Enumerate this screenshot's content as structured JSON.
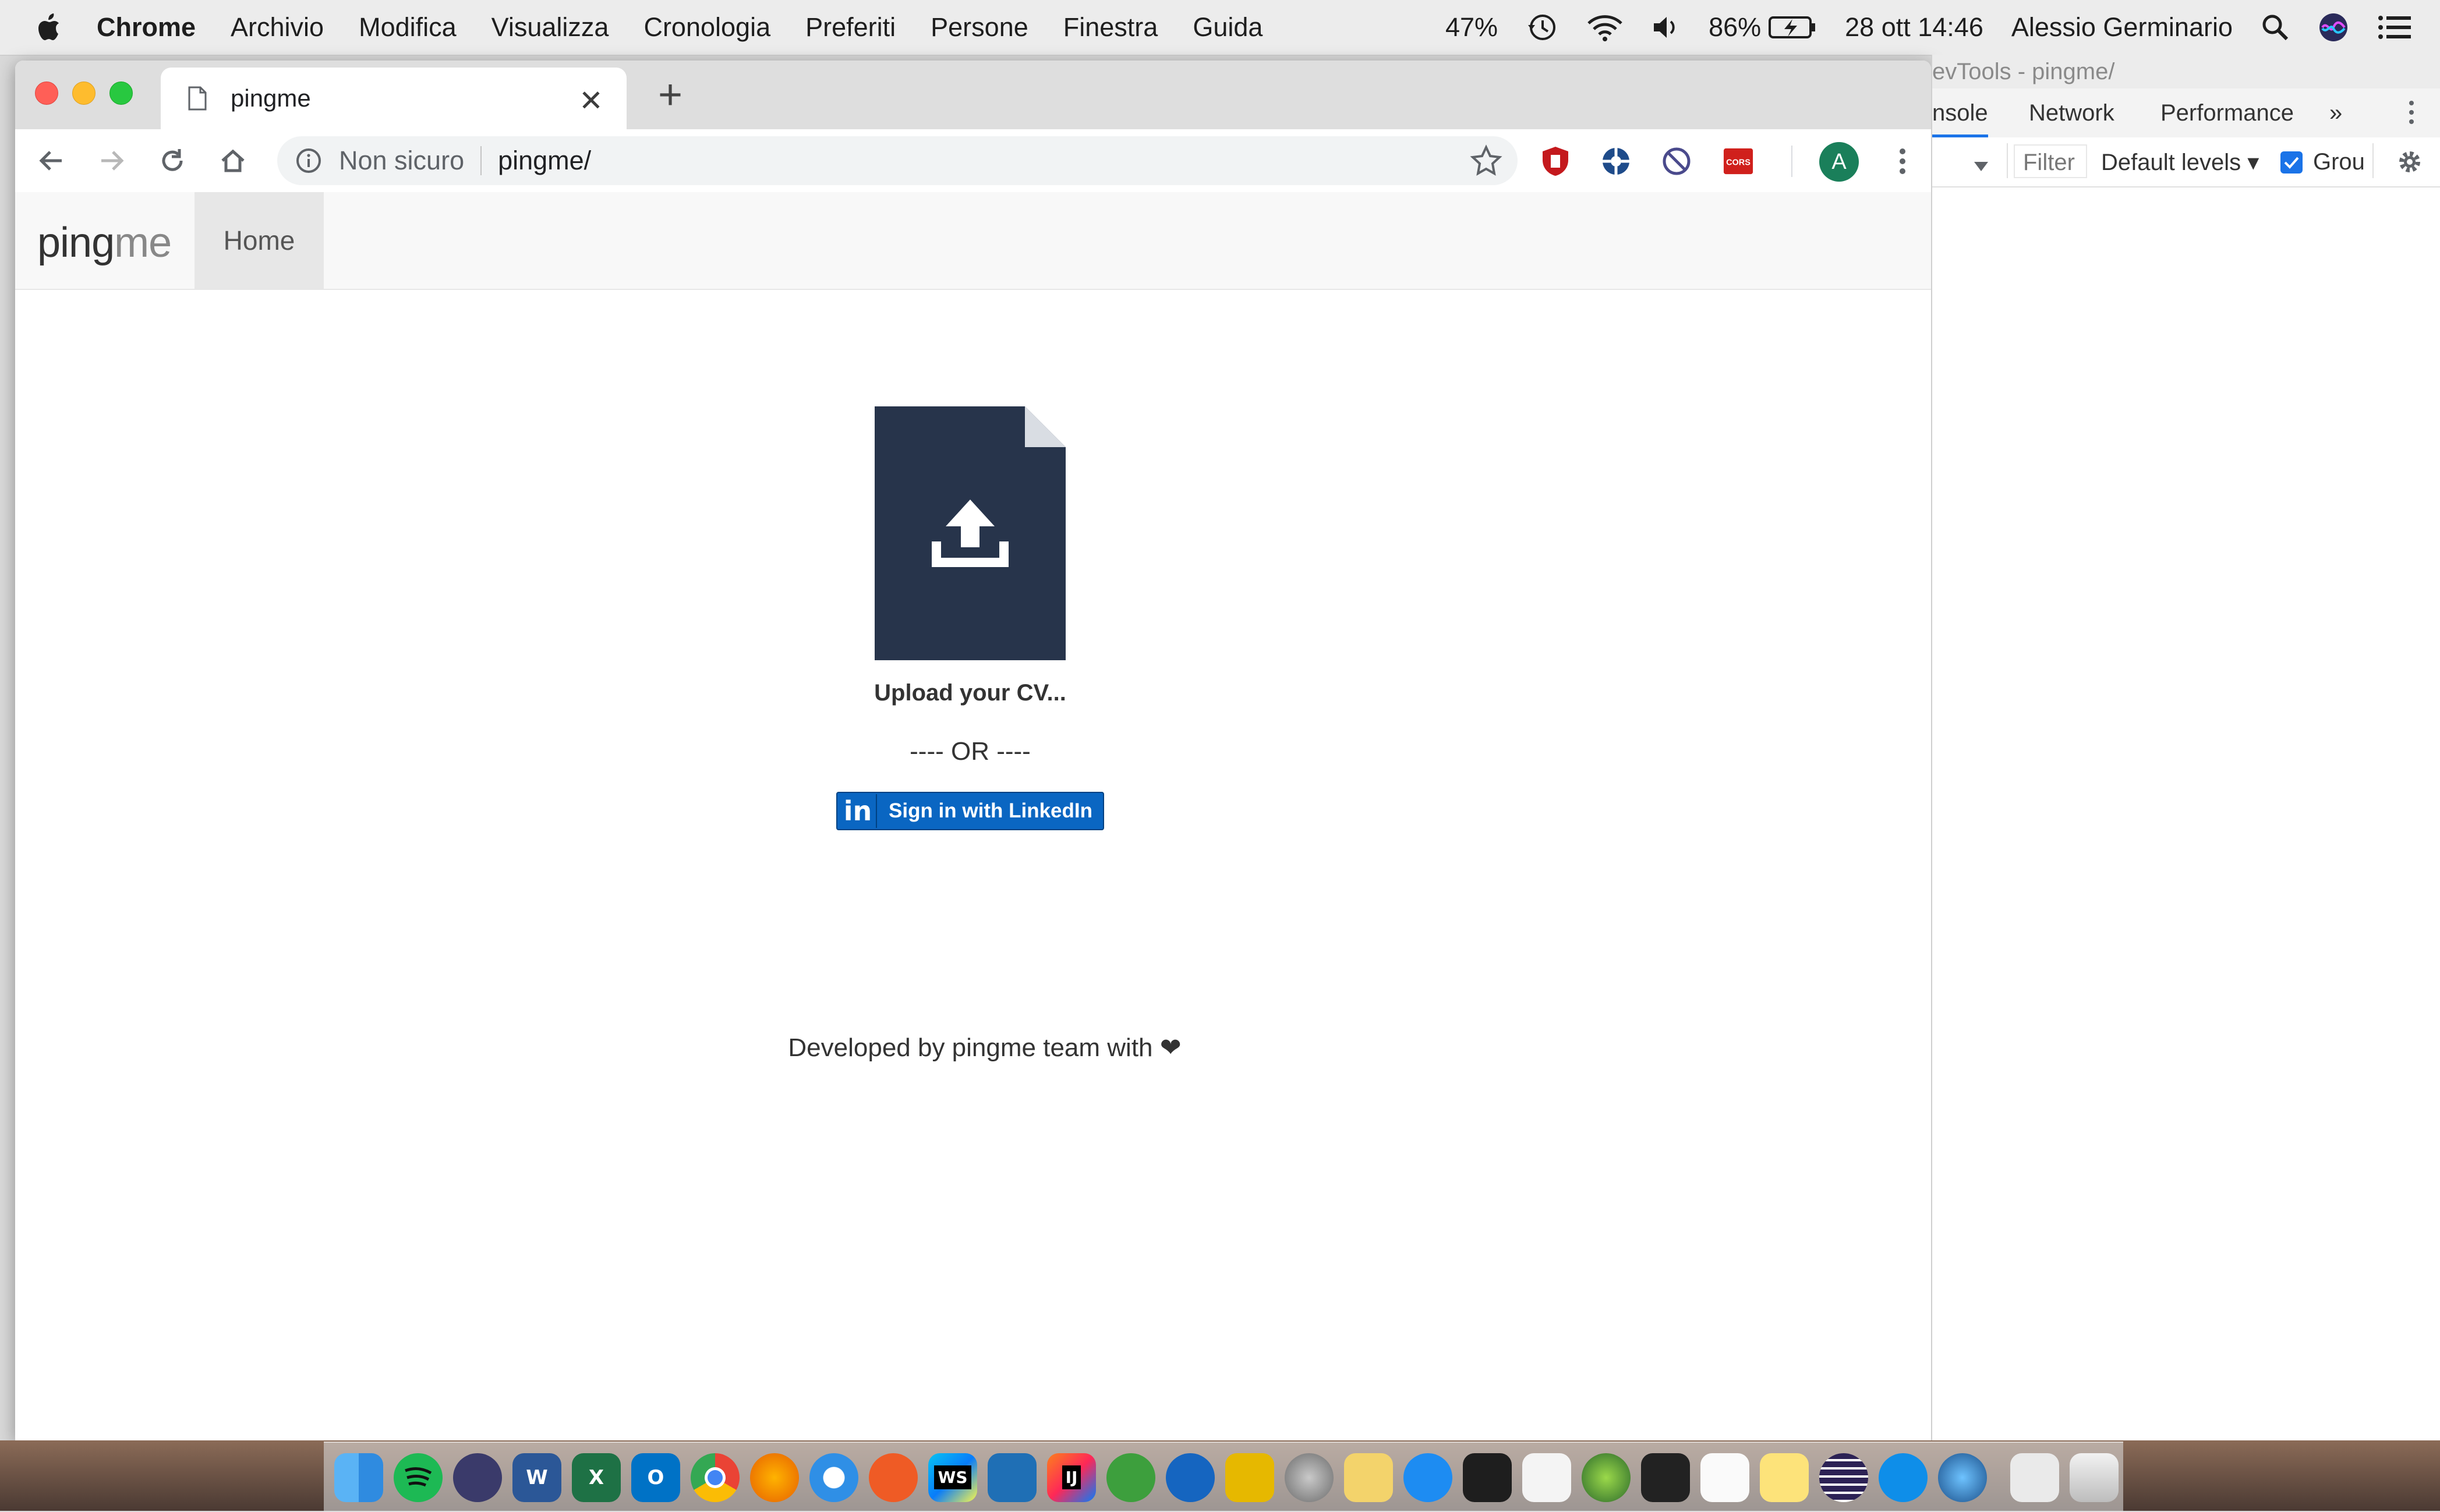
{
  "menubar": {
    "app_name": "Chrome",
    "menus": [
      "Archivio",
      "Modifica",
      "Visualizza",
      "Cronologia",
      "Preferiti",
      "Persone",
      "Finestra",
      "Guida"
    ],
    "cpu": "47%",
    "battery": "86%",
    "datetime": "28 ott 14:46",
    "user": "Alessio Germinario"
  },
  "browser": {
    "tab_title": "pingme",
    "omnibox": {
      "security_label": "Non sicuro",
      "url": "pingme/"
    },
    "profile_initial": "A",
    "extensions": [
      "ublock-icon",
      "extension-blue-icon",
      "block-icon",
      "cors-icon"
    ],
    "cors_label": "CORS"
  },
  "page": {
    "brand_ping": "ping",
    "brand_me": "me",
    "nav_home": "Home",
    "upload_label": "Upload your CV...",
    "or_divider": "---- OR ----",
    "linkedin_label": "Sign in with LinkedIn",
    "linkedin_logo": "in",
    "footer_text": "Developed by pingme team with ❤",
    "colors": {
      "upload_card": "#27344b",
      "linkedin": "#0a66c2"
    }
  },
  "devtools": {
    "title": "evTools - pingme/",
    "tabs": [
      "nsole",
      "Network",
      "Performance"
    ],
    "more": "»",
    "filter_placeholder": "Filter",
    "levels": "Default levels ▾",
    "group": "Grou"
  },
  "dock": {
    "apps": [
      "finder",
      "spotify",
      "siri",
      "word",
      "excel",
      "outlook",
      "chrome",
      "firefox",
      "safari",
      "postman",
      "webstorm",
      "vscode",
      "intellij",
      "sourcetree",
      "maps",
      "filezilla",
      "system-preferences",
      "stickies",
      "app-store",
      "terminal",
      "textedit",
      "gis",
      "activity-monitor",
      "preview",
      "notes",
      "eclipse",
      "teamviewer",
      "quicktime",
      "downloads",
      "trash"
    ],
    "word_letter": "W",
    "excel_letter": "X",
    "outlook_letter": "O",
    "webstorm_letter": "WS",
    "intellij_letter": "IJ"
  }
}
